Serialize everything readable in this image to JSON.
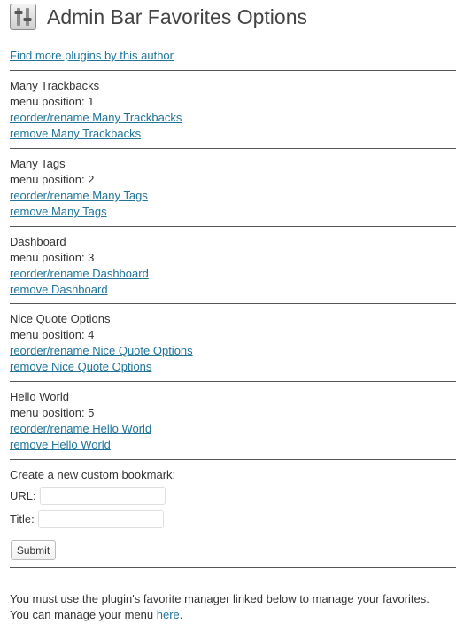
{
  "header": {
    "icon": "settings-sliders-icon",
    "title": "Admin Bar Favorites Options"
  },
  "author_link": "Find more plugins by this author",
  "favorites": [
    {
      "name": "Many Trackbacks",
      "position_label": "menu position: 1",
      "reorder_label": "reorder/rename Many Trackbacks",
      "remove_label": "remove Many Trackbacks"
    },
    {
      "name": "Many Tags",
      "position_label": "menu position: 2",
      "reorder_label": "reorder/rename Many Tags",
      "remove_label": "remove Many Tags"
    },
    {
      "name": "Dashboard",
      "position_label": "menu position: 3",
      "reorder_label": "reorder/rename Dashboard",
      "remove_label": "remove Dashboard"
    },
    {
      "name": "Nice Quote Options",
      "position_label": "menu position: 4",
      "reorder_label": "reorder/rename Nice Quote Options",
      "remove_label": "remove Nice Quote Options"
    },
    {
      "name": "Hello World",
      "position_label": "menu position: 5",
      "reorder_label": "reorder/rename Hello World",
      "remove_label": "remove Hello World"
    }
  ],
  "create": {
    "heading": "Create a new custom bookmark:",
    "url_label": "URL:",
    "url_value": "",
    "title_label": "Title:",
    "title_value": "",
    "submit_label": "Submit"
  },
  "footer": {
    "notice": "You must use the plugin's favorite manager linked below to manage your favorites.",
    "manage_prefix": "You can manage your menu ",
    "manage_link": "here",
    "manage_suffix": "."
  },
  "colors": {
    "link": "#21759b",
    "text": "#333333",
    "divider": "#555555"
  }
}
